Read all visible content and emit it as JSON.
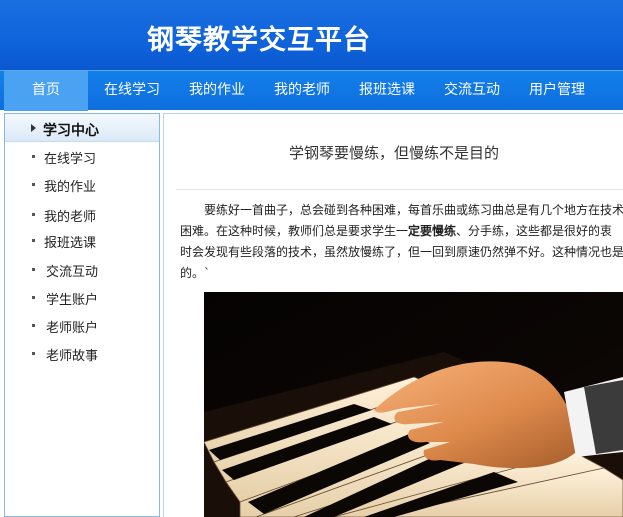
{
  "header": {
    "title": "钢琴教学交互平台"
  },
  "nav": {
    "items": [
      "首页",
      "在线学习",
      "我的作业",
      "我的老师",
      "报班选课",
      "交流互动",
      "用户管理"
    ],
    "active": "首页"
  },
  "sidebar": {
    "heading": "学习中心",
    "items": [
      "在线学习",
      "我的作业",
      "我的老师",
      "报班选课",
      "交流互动",
      "学生账户",
      "老师账户",
      "老师故事"
    ]
  },
  "article": {
    "title": "学钢琴要慢练，但慢练不是目的",
    "para_line1": "要练好一首曲子，总会碰到各种困难，每首乐曲或练习曲总是有几个地方在技术",
    "para_line2_a": "困难。在这种时候，教师们总是要求学生一",
    "para_line2_bold": "定要慢练",
    "para_line2_b": "、分手练，这些都是很好的衷",
    "para_line3": "时会发现有些段落的技术，虽然放慢练了，但一回到原速仍然弹不好。这种情况也是",
    "para_line4": "的。`"
  },
  "colors": {
    "header_bg": "#0f63db",
    "nav_bg": "#1076e4",
    "nav_active": "#4ba2f2",
    "sidebar_border": "#8ab8e8"
  }
}
